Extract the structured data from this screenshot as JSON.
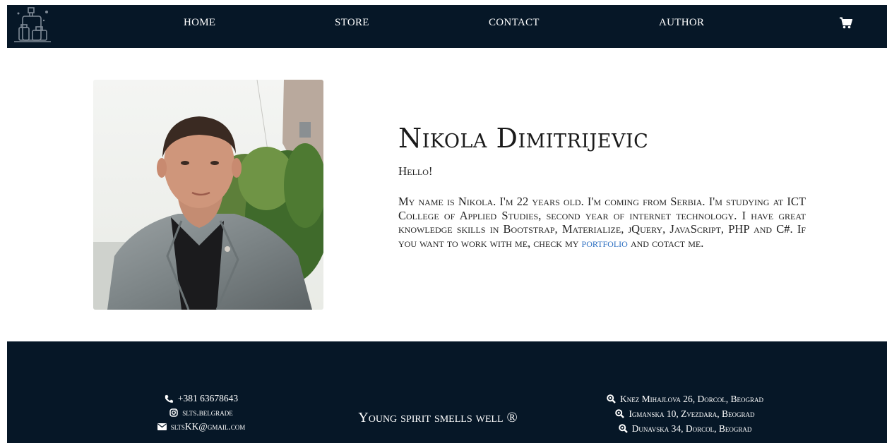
{
  "nav": {
    "home": "HOME",
    "store": "STORE",
    "contact": "CONTACT",
    "author": "AUTHOR",
    "cart_icon": "shopping-cart-icon",
    "logo_icon": "perfume-bottles-logo"
  },
  "author": {
    "name": "Nikola Dimitrijevic",
    "greeting": "Hello!",
    "bio_before_link": "My name is Nikola. I'm 22 years old. I'm coming from Serbia. I'm studying at ICT College of Applied Studies, second year of internet technology. I have great knowledge skills in Bootstrap, Materialize, jQuery, JavaScript, PHP and C#. If you want to work with me, check my ",
    "bio_link": "portfolio",
    "bio_after_link": " and cotact me."
  },
  "footer": {
    "phone": "+381 63678643",
    "instagram": "slts.belgrade",
    "email": "sltsKK@gmail.com",
    "slogan": "Young spirit smells well ®",
    "addresses": [
      "Knez Mihajlova 26, Dorcol, Beograd",
      "Igmanska 10, Zvezdara, Beograd",
      "Dunavska 34, Dorcol, Beograd"
    ]
  },
  "colors": {
    "navbar_bg": "#061727",
    "link": "#2d6fc1"
  }
}
